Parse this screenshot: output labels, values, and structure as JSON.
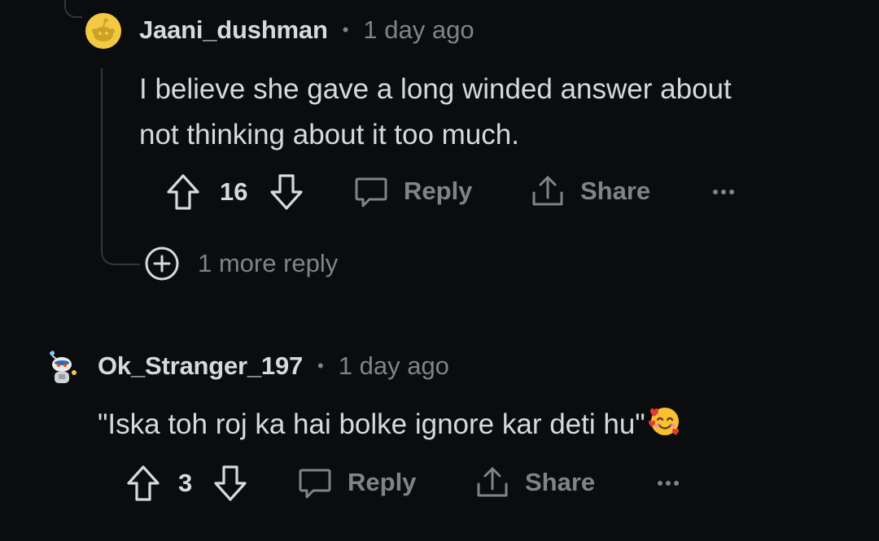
{
  "comments": [
    {
      "username": "Jaani_dushman",
      "separator": "•",
      "time": "1 day ago",
      "text_line1": "I believe she gave a long winded answer about",
      "text_line2": "not thinking about it too much.",
      "votes": "16",
      "reply_label": "Reply",
      "share_label": "Share",
      "more_replies": "1 more reply"
    },
    {
      "username": "Ok_Stranger_197",
      "separator": "•",
      "time": "1 day ago",
      "text": "\"Iska toh roj ka hai bolke ignore kar deti hu\"",
      "emoji": "smiling-face-with-hearts",
      "votes": "3",
      "reply_label": "Reply",
      "share_label": "Share"
    }
  ],
  "colors": {
    "background": "#0b0c0e",
    "text": "#d7dadc",
    "muted": "#818384",
    "thread_line": "#343536",
    "avatar_yellow": "#f3c843"
  }
}
